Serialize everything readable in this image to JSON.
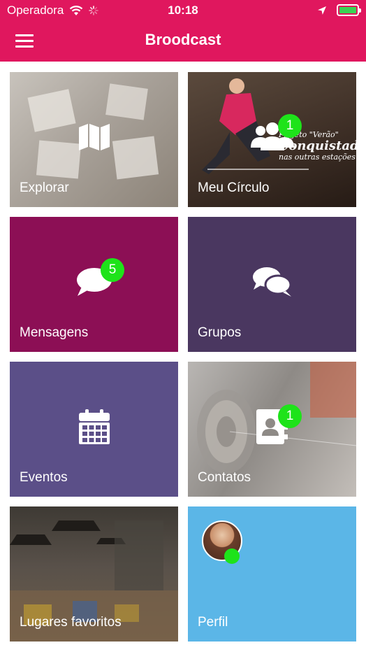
{
  "status_bar": {
    "carrier": "Operadora",
    "time": "10:18"
  },
  "nav": {
    "title": "Broodcast",
    "menu_icon": "hamburger-icon"
  },
  "tiles": [
    {
      "id": "explorar",
      "label": "Explorar",
      "icon": "map-icon",
      "badge": null
    },
    {
      "id": "meu-circulo",
      "label": "Meu Círculo",
      "icon": "users-icon",
      "badge": "1",
      "background_text": {
        "line1": "Projeto \"Verão\"",
        "line2": "Conquistado",
        "line3": "nas outras estações."
      }
    },
    {
      "id": "mensagens",
      "label": "Mensagens",
      "icon": "chat-bubble-icon",
      "badge": "5"
    },
    {
      "id": "grupos",
      "label": "Grupos",
      "icon": "chat-bubbles-icon",
      "badge": null
    },
    {
      "id": "eventos",
      "label": "Eventos",
      "icon": "calendar-icon",
      "badge": null
    },
    {
      "id": "contatos",
      "label": "Contatos",
      "icon": "address-book-icon",
      "badge": "1"
    },
    {
      "id": "lugares-favoritos",
      "label": "Lugares favoritos",
      "icon": null,
      "badge": null
    },
    {
      "id": "perfil",
      "label": "Perfil",
      "icon": "avatar",
      "badge": null
    }
  ],
  "colors": {
    "primary": "#e0175e",
    "badge_green": "#1ee31a",
    "mensagens_bg": "#8c0f55",
    "grupos_bg": "#4a3760",
    "eventos_bg": "#5b4f88",
    "perfil_bg": "#5bb6e7"
  }
}
